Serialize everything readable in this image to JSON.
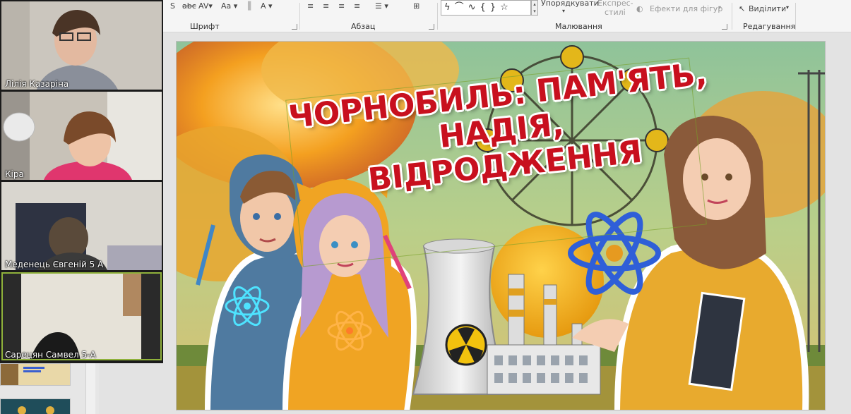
{
  "ribbon": {
    "groups": {
      "font": "Шрифт",
      "paragraph": "Абзац",
      "drawing": "Малювання",
      "editing": "Редагування"
    },
    "arrange_label": "Упорядкувати",
    "quick_styles_label": "Експрес-\nстилі",
    "quick_styles_line1": "Експрес-",
    "quick_styles_line2": "стилі",
    "shape_effects_label": "Ефекти для фігур",
    "select_label": "Виділити"
  },
  "participants": [
    {
      "name": "Лілія Казаріна"
    },
    {
      "name": "Кіра"
    },
    {
      "name": "Меденець Євгеній 5 А"
    },
    {
      "name": "Сарецян Самвел 5-А"
    }
  ],
  "slide": {
    "title_lines": [
      "ЧОРНОБИЛЬ: ПАМ'ЯТЬ,",
      "НАДІЯ,",
      "ВІДРОДЖЕННЯ"
    ]
  },
  "colors": {
    "title_red": "#c8101e",
    "active_speaker": "#8fb13b"
  }
}
